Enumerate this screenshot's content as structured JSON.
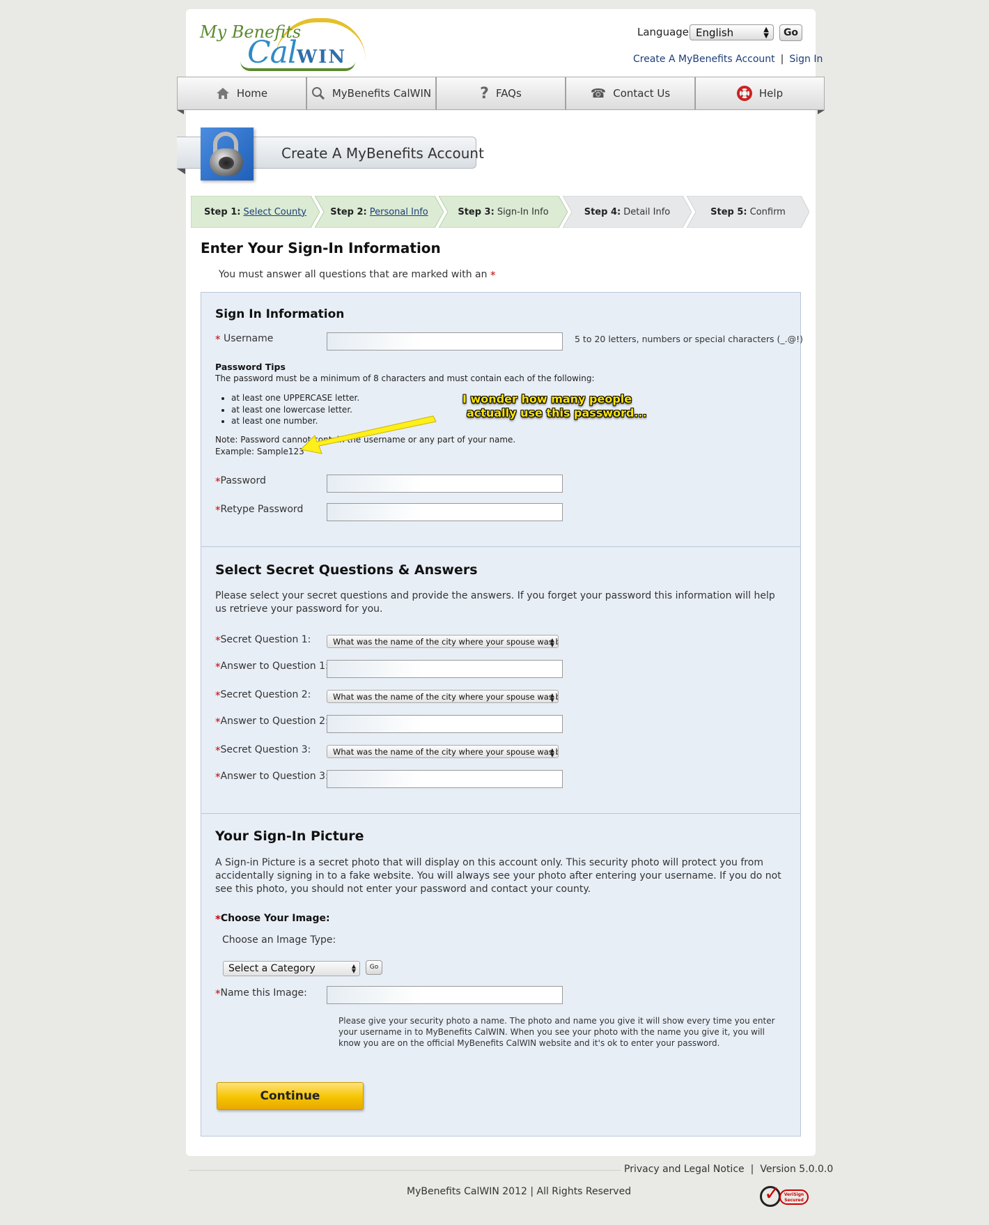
{
  "header": {
    "logo_text_1": "My Benefits",
    "logo_text_2": "Cal",
    "logo_text_3": "WIN",
    "language_label": "Language",
    "language_value": "English",
    "go_label": "Go",
    "create_account_link": "Create A MyBenefits Account",
    "sign_in_link": "Sign In"
  },
  "nav": [
    {
      "label": "Home",
      "icon": "home-icon"
    },
    {
      "label": "MyBenefits CalWIN",
      "icon": "search-icon"
    },
    {
      "label": "FAQs",
      "icon": "question-icon"
    },
    {
      "label": "Contact Us",
      "icon": "phone-icon"
    },
    {
      "label": "Help",
      "icon": "lifebuoy-icon"
    }
  ],
  "banner": {
    "title": "Create A MyBenefits Account"
  },
  "steps": [
    {
      "num": "Step 1:",
      "label": "Select County",
      "link": true,
      "state": "done"
    },
    {
      "num": "Step 2:",
      "label": "Personal Info",
      "link": true,
      "state": "done"
    },
    {
      "num": "Step 3:",
      "label": "Sign-In Info",
      "link": false,
      "state": "current"
    },
    {
      "num": "Step 4:",
      "label": "Detail Info",
      "link": false,
      "state": "todo"
    },
    {
      "num": "Step 5:",
      "label": "Confirm",
      "link": false,
      "state": "todo"
    }
  ],
  "page": {
    "title": "Enter Your Sign-In Information",
    "required_note": "You must answer all questions that are marked with an",
    "required_star": "*"
  },
  "sign_in": {
    "title": "Sign In Information",
    "username_label": "Username",
    "username_hint": "5 to 20 letters, numbers or special characters (_.@!)",
    "tips_title": "Password Tips",
    "tips_intro": "The password must be a minimum of 8 characters and must contain each of the following:",
    "tips": [
      "at least one UPPERCASE letter.",
      "at least one lowercase letter.",
      "at least one number."
    ],
    "tips_note": "Note: Password cannot contain the username or any part of your name.",
    "tips_example": "Example: Sample123",
    "password_label": "Password",
    "retype_label": "Retype Password"
  },
  "annotation": {
    "line1": "I wonder how many people",
    "line2": "actually use this password..."
  },
  "secret": {
    "title": "Select Secret Questions & Answers",
    "description": "Please select your secret questions and provide the answers. If you forget your password this information will help us retrieve your password for you.",
    "q1_label": "Secret Question 1:",
    "a1_label": "Answer to Question 1:",
    "q2_label": "Secret Question 2:",
    "a2_label": "Answer to Question 2:",
    "q3_label": "Secret Question 3:",
    "a3_label": "Answer to Question 3:",
    "question_value": "What was the name of the city where your spouse was b"
  },
  "picture": {
    "title": "Your Sign-In Picture",
    "description": "A Sign-in Picture is a secret photo that will display on this account only. This security photo will protect you from accidentally signing in to a fake website. You will always see your photo after entering your username. If you do not see this photo, you should not enter your password and contact your county.",
    "choose_label": "Choose Your Image:",
    "type_label": "Choose an Image Type:",
    "category_value": "Select a Category",
    "go_label": "Go",
    "name_label": "Name this Image:",
    "name_help": "Please give your security photo a name. The photo and name you give it will show every time you enter your username in to MyBenefits CalWIN. When you see your photo with the name you give it, you will know you are on the official MyBenefits CalWIN website and it's ok to enter your password."
  },
  "continue_label": "Continue",
  "footer": {
    "privacy": "Privacy and Legal Notice",
    "version": "Version 5.0.0.0",
    "copyright": "MyBenefits CalWIN 2012 | All Rights Reserved",
    "badge_text": "VeriSign Secured"
  }
}
